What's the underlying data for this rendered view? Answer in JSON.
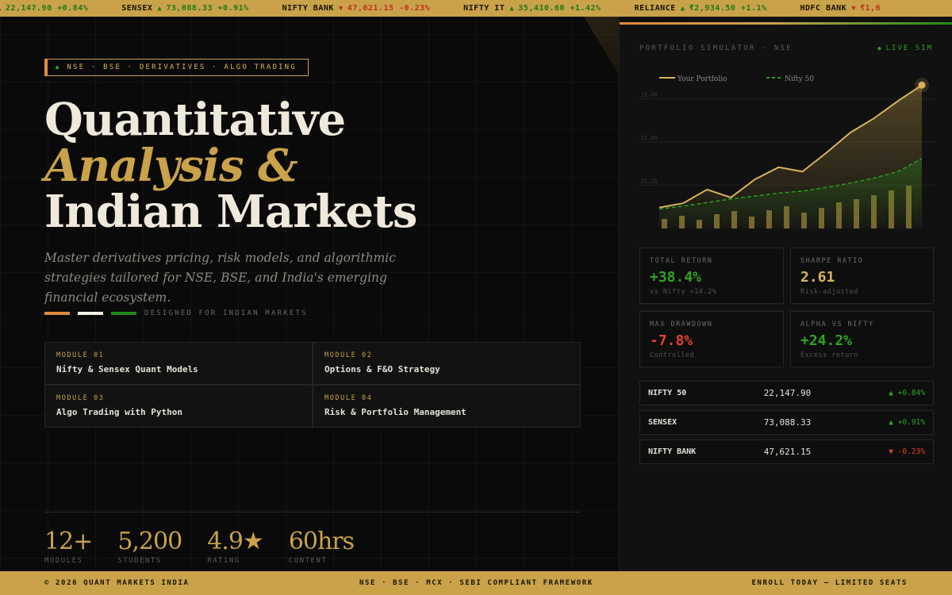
{
  "ticker": [
    {
      "symbol": "",
      "direction": "up",
      "value": "22,147.90",
      "change": "+0.84%"
    },
    {
      "symbol": "SENSEX",
      "direction": "up",
      "value": "73,088.33",
      "change": "+0.91%"
    },
    {
      "symbol": "NIFTY BANK",
      "direction": "down",
      "value": "47,621.15",
      "change": "-0.23%"
    },
    {
      "symbol": "NIFTY IT",
      "direction": "up",
      "value": "35,410.60",
      "change": "+1.42%"
    },
    {
      "symbol": "RELIANCE",
      "direction": "up",
      "value": "₹2,934.50",
      "change": "+1.1%"
    },
    {
      "symbol": "HDFC BANK",
      "direction": "down",
      "value": "₹1,6",
      "change": ""
    }
  ],
  "hero": {
    "tagline": "NSE · BSE · DERIVATIVES · ALGO TRADING",
    "title_line1": "Quantitative",
    "title_line2": "Analysis &",
    "title_line3": "Indian Markets",
    "subtitle": "Master derivatives pricing, risk models, and algorithmic strategies tailored for NSE, BSE, and India's emerging financial ecosystem.",
    "flag_label": "DESIGNED FOR INDIAN MARKETS"
  },
  "modules": [
    {
      "number": "MODULE 01",
      "title": "Nifty & Sensex Quant Models"
    },
    {
      "number": "MODULE 02",
      "title": "Options & F&O Strategy"
    },
    {
      "number": "MODULE 03",
      "title": "Algo Trading with Python"
    },
    {
      "number": "MODULE 04",
      "title": "Risk & Portfolio Management"
    }
  ],
  "stats": [
    {
      "value": "12+",
      "label": "MODULES"
    },
    {
      "value": "5,200",
      "label": "STUDENTS"
    },
    {
      "value": "4.9★",
      "label": "RATING"
    },
    {
      "value": "60hrs",
      "label": "CONTENT"
    }
  ],
  "panel": {
    "label": "PORTFOLIO SIMULATOR · NSE",
    "live": "LIVE SIM",
    "kpis": [
      {
        "label": "TOTAL RETURN",
        "value": "+38.4%",
        "sub": "vs Nifty +14.2%",
        "color": "#2fa321"
      },
      {
        "label": "SHARPE RATIO",
        "value": "2.61",
        "sub": "Risk-adjusted",
        "color": "#d9b35c"
      },
      {
        "label": "MAX DRAWDOWN",
        "value": "-7.8%",
        "sub": "Controlled",
        "color": "#e0432e"
      },
      {
        "label": "ALPHA VS NIFTY",
        "value": "+24.2%",
        "sub": "Excess return",
        "color": "#2fa321"
      }
    ],
    "indices": [
      {
        "name": "NIFTY 50",
        "value": "22,147.90",
        "change": "▲ +0.84%",
        "direction": "up"
      },
      {
        "name": "SENSEX",
        "value": "73,088.33",
        "change": "▲ +0.91%",
        "direction": "up"
      },
      {
        "name": "NIFTY BANK",
        "value": "47,621.15",
        "change": "▼ -0.23%",
        "direction": "down"
      }
    ]
  },
  "chart_data": {
    "type": "line",
    "title": "",
    "xlabel": "",
    "ylabel": "",
    "y_ticks": [
      "22.4k",
      "21.8k",
      "21.2k"
    ],
    "ylim": [
      20600,
      22450
    ],
    "legend_position": "top-left",
    "series": [
      {
        "name": "Your Portfolio",
        "color": "#d9b35c",
        "style": "solid",
        "values": [
          20890,
          20950,
          21140,
          21030,
          21280,
          21450,
          21390,
          21650,
          21930,
          22130,
          22370,
          22590
        ]
      },
      {
        "name": "Nifty 50",
        "color": "#2a9b22",
        "style": "dashed",
        "values": [
          20870,
          20910,
          20960,
          21010,
          21050,
          21090,
          21120,
          21170,
          21230,
          21300,
          21390,
          21570
        ]
      }
    ],
    "volume_bars": [
      12,
      16,
      11,
      18,
      22,
      15,
      23,
      28,
      20,
      26,
      33,
      37,
      42,
      48,
      54
    ],
    "colors": {
      "area": "#c9a24a",
      "bars": "#8a7335",
      "grid": "#1f1f1f"
    }
  },
  "footer": {
    "left": "© 2026 QUANT MARKETS INDIA",
    "center": "NSE · BSE · MCX · SEBI COMPLIANT FRAMEWORK",
    "right": "ENROLL TODAY — LIMITED SEATS"
  }
}
